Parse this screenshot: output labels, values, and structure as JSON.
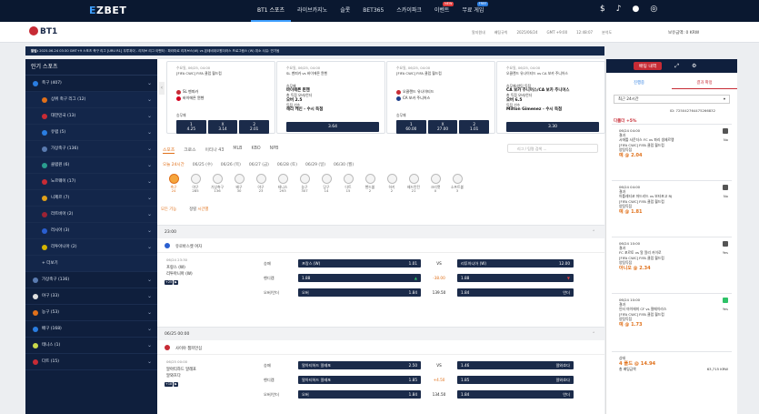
{
  "topnav": {
    "logo_prefix": "E",
    "logo_rest": "ZBET",
    "menu": [
      {
        "label": "BT1 스포츠",
        "badge": ""
      },
      {
        "label": "라이브카지노",
        "badge": ""
      },
      {
        "label": "슬롯",
        "badge": ""
      },
      {
        "label": "BET365",
        "badge": ""
      },
      {
        "label": "스카이파크",
        "badge": ""
      },
      {
        "label": "이벤트",
        "badge": "NEW"
      },
      {
        "label": "무료 게임",
        "badge": "FREE"
      }
    ]
  },
  "subbar": {
    "brand": "BT1",
    "links": [
      "알지원내",
      "배팅규칙",
      "2025/06/24",
      "GMT +9:00",
      "12:48:07",
      "분석도"
    ],
    "balance_label": "보유금액:",
    "balance": "0 KRW"
  },
  "ticker": {
    "label": "알림:",
    "text": "2025-06-24 03:30 GMT+9 스포츠 축구 리그 [URU R1] 우루과이 - 리저브 리그 아펜타 : 파라마르 리저브스(W) vs 몬테비데오원더러스 프로그램스 (W) 취소 사유: 연기됨"
  },
  "sidebar": {
    "title": "인기 스포츠",
    "items": [
      {
        "label": "축구 (407)",
        "color": "#2a7de1",
        "sub": false
      },
      {
        "label": "상위 축구 리그 (12)",
        "color": "#e0701a",
        "sub": true
      },
      {
        "label": "대한민국 (13)",
        "color": "#c72b35",
        "sub": true
      },
      {
        "label": "유럽 (5)",
        "color": "#2a7de1",
        "sub": true
      },
      {
        "label": "가상축구 (136)",
        "color": "#5a7bb0",
        "sub": true
      },
      {
        "label": "클럽원 (6)",
        "color": "#2a9d8f",
        "sub": true
      },
      {
        "label": "노르웨이 (17)",
        "color": "#c72b35",
        "sub": true
      },
      {
        "label": "니제르 (7)",
        "color": "#e0a01a",
        "sub": true
      },
      {
        "label": "라트비아 (2)",
        "color": "#9b2335",
        "sub": true
      },
      {
        "label": "러시아 (3)",
        "color": "#2a5fd0",
        "sub": true
      },
      {
        "label": "리투아니아 (2)",
        "color": "#d4b400",
        "sub": true
      },
      {
        "label": "+ 더보기",
        "color": "",
        "sub": true
      },
      {
        "label": "가상축구 (136)",
        "color": "#5a7bb0",
        "sub": false
      },
      {
        "label": "야구 (33)",
        "color": "#e0e0e0",
        "sub": false
      },
      {
        "label": "농구 (53)",
        "color": "#e0701a",
        "sub": false
      },
      {
        "label": "배구 (168)",
        "color": "#2a7de1",
        "sub": false
      },
      {
        "label": "테니스 (1)",
        "color": "#c9d94b",
        "sub": false
      },
      {
        "label": "다트 (15)",
        "color": "#c72b35",
        "sub": false
      }
    ]
  },
  "cards": [
    {
      "when": "수요일, 06/25, 04:00",
      "title": "[FIFA CWC] FIFA 클럽 월드컵",
      "team1": "SL 벤피카",
      "team2": "바이에른 뮌헨",
      "market": "승무패",
      "odds": [
        {
          "l": "1",
          "v": "4.25"
        },
        {
          "l": "X",
          "v": "3.14"
        },
        {
          "l": "2",
          "v": "2.01"
        }
      ],
      "lines": []
    },
    {
      "when": "수요일, 06/25, 04:00",
      "title": "SL 벤피카 vs 바이에른 뮌헨",
      "team1": "",
      "team2": "",
      "market": "",
      "odds": [],
      "lines": [
        "승무패",
        "바이에른 뮌헨",
        "총 득점 오버/언더",
        "오버 2.5",
        "득점 선수",
        "해리 케인 - 수시 득점"
      ],
      "big": "3.64"
    },
    {
      "when": "수요일, 06/25, 04:00",
      "title": "[FIFA CWC] FIFA 클럽 월드컵",
      "team1": "오클랜드 유나이티드",
      "team2": "CA 보카 주니어스",
      "market": "승무패",
      "odds": [
        {
          "l": "1",
          "v": "60.00"
        },
        {
          "l": "X",
          "v": "27.00"
        },
        {
          "l": "2",
          "v": "1.01"
        }
      ],
      "lines": []
    },
    {
      "when": "수요일, 06/25, 04:00",
      "title": "오클랜드 유나이티드 vs CA 보카 주니어스",
      "team1": "",
      "team2": "",
      "market": "",
      "odds": [],
      "lines": [
        "승무패/양팀 득점",
        "CA 보카 주니어스/CA 보카 주니어스",
        "총 득점 오버/언더",
        "오버 6.5",
        "득점 선수",
        "Milton Gimenez - 수시 득점"
      ],
      "big": "3.30"
    }
  ],
  "sporttabs": [
    "스포츠",
    "크로스",
    "이티나 43",
    "MLB",
    "KBO",
    "NPB"
  ],
  "search_placeholder": "리그 / 팀명 검색 ...",
  "datetabs": [
    "오늘 24시간",
    "06/25 (수)",
    "06/26 (목)",
    "06/27 (금)",
    "06/28 (토)",
    "06/29 (일)",
    "06/30 (월)"
  ],
  "sporticons": [
    {
      "name": "축구",
      "count": "24"
    },
    {
      "name": "야구",
      "count": "285"
    },
    {
      "name": "가상축구",
      "count": "136"
    },
    {
      "name": "배구",
      "count": "30"
    },
    {
      "name": "야구",
      "count": "23"
    },
    {
      "name": "테니스",
      "count": "293"
    },
    {
      "name": "농구",
      "count": "307"
    },
    {
      "name": "당구",
      "count": "14"
    },
    {
      "name": "다트",
      "count": "15"
    },
    {
      "name": "핸드볼",
      "count": "2"
    },
    {
      "name": "하키",
      "count": "2"
    },
    {
      "name": "배드민턴",
      "count": "21"
    },
    {
      "name": "크리켓",
      "count": "0"
    },
    {
      "name": "소프트볼",
      "count": "3"
    }
  ],
  "filters": {
    "all": "모든 기능",
    "sort_label": "정렬",
    "sort_value": "시간별"
  },
  "sections": [
    {
      "time": "23:00",
      "league": "유로바스켓 여자",
      "match_time": "06/24 23:30",
      "team1": "프랑스 (W)",
      "team2": "리투아니아 (W)",
      "tag": "+25",
      "rows": [
        {
          "label": "승패",
          "left": "프랑스 (W)",
          "lv": "1.01",
          "mid": "VS",
          "right": "리투아니아 (W)",
          "rv": "12.00"
        },
        {
          "label": "핸디캡",
          "left": "1.88",
          "lv": "",
          "mid": "-38.00",
          "right": "1.88",
          "rv": ""
        },
        {
          "label": "오버/언더",
          "left": "오버",
          "lv": "1.84",
          "mid": "139.50",
          "right": "1.84",
          "rv": "언더"
        }
      ]
    },
    {
      "time": "06/25 00:00",
      "league": "사이야 챔피언십",
      "match_time": "06/25 00:00",
      "team1": "알아티하드 알레포",
      "team2": "알와흐다",
      "tag": "+18",
      "rows": [
        {
          "label": "승패",
          "left": "알아티하드 알레포",
          "lv": "2.50",
          "mid": "VS",
          "right": "1.46",
          "rv": "알와흐다"
        },
        {
          "label": "핸디캡",
          "left": "알아티하드 알레포",
          "lv": "1.85",
          "mid": "+4.50",
          "right": "1.85",
          "rv": "알와흐다"
        },
        {
          "label": "오버/언더",
          "left": "오버",
          "lv": "1.84",
          "mid": "134.50",
          "right": "1.84",
          "rv": "언더"
        }
      ]
    }
  ],
  "betslip": {
    "title": "배팅 내역",
    "tabs": [
      "진행중",
      "결과 확정"
    ],
    "period": "최근 24시간",
    "bet_id": "ID: 725042764475266832",
    "multi": "다폴더 +5%",
    "items": [
      {
        "time": "06/24 04:00",
        "market": "결과",
        "match": "시애틀 사운더스 FC vs 파리 생제르맹",
        "league": "[FIFA CWC] FIFA 클럽 월드컵",
        "type": "양팀득점",
        "pick": "예 @ 2.04",
        "status": "No",
        "win": false
      },
      {
        "time": "06/24 04:00",
        "market": "결과",
        "match": "아틀레티코 마드리드 vs 보타포고 RJ",
        "league": "[FIFA CWC] FIFA 클럽 월드컵",
        "type": "양팀득점",
        "pick": "예 @ 1.81",
        "status": "No",
        "win": false
      },
      {
        "time": "06/24 10:00",
        "market": "결과",
        "match": "FC 포르토 vs 알 알리 카이로",
        "league": "[FIFA CWC] FIFA 클럽 월드컵",
        "type": "양팀득점",
        "pick": "아니오 @ 2.34",
        "status": "Yes",
        "win": false
      },
      {
        "time": "06/24 10:00",
        "market": "결과",
        "match": "인터 마이애미 CF vs 팔메이라스",
        "league": "[FIFA CWC] FIFA 클럽 월드컵",
        "type": "양팀득점",
        "pick": "예 @ 1.73",
        "status": "Yes",
        "win": true
      }
    ],
    "summary": {
      "status": "상태",
      "line": "4 폴드 @ 14.94",
      "amount_label": "총 배팅금액",
      "amount": "63,715 KRW"
    }
  }
}
